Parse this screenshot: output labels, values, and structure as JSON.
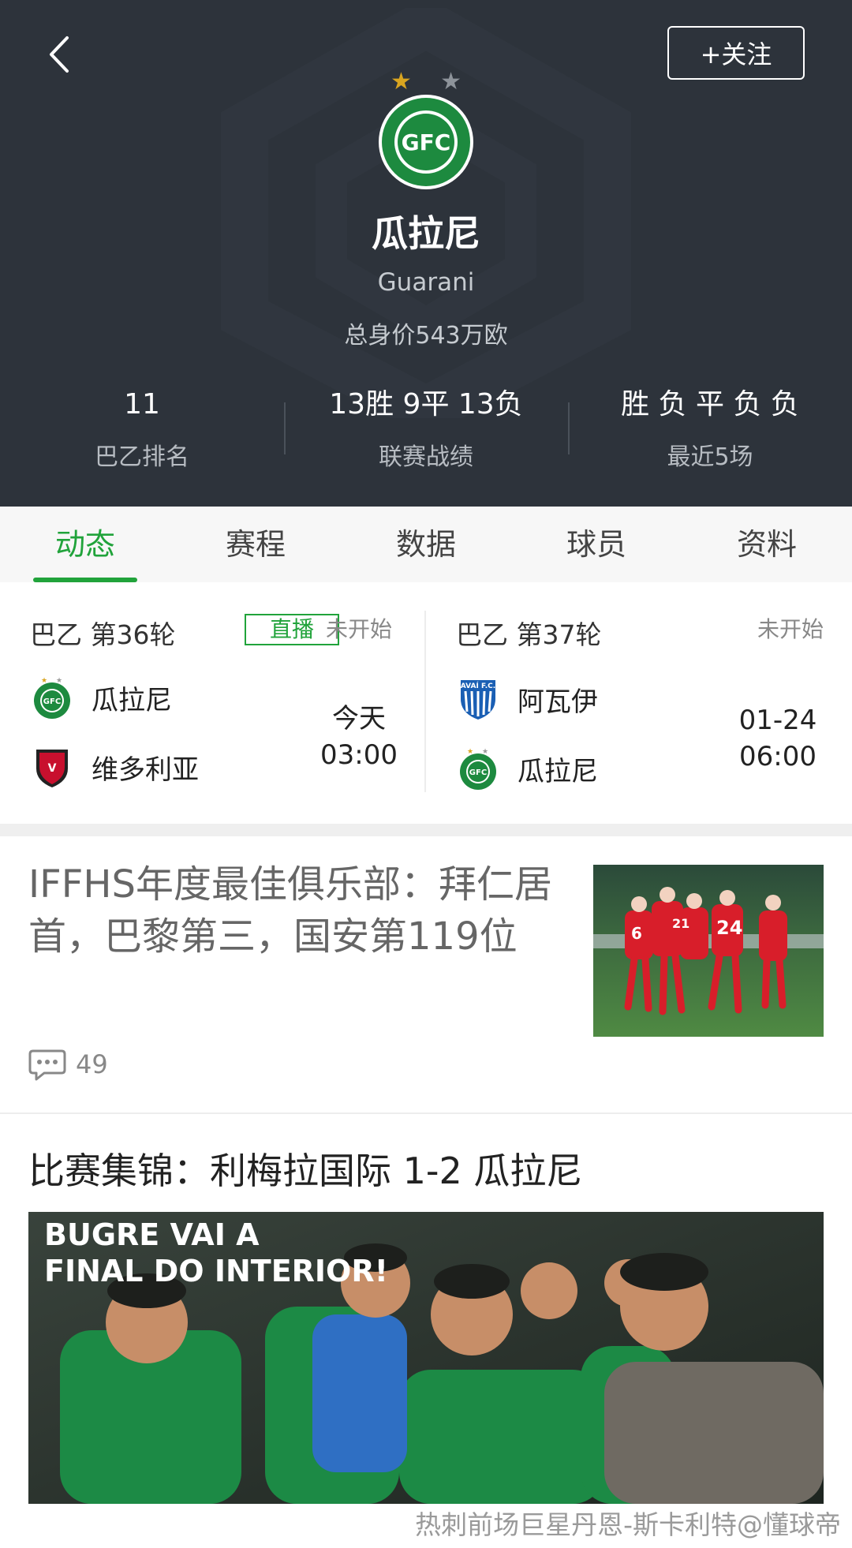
{
  "header": {
    "follow_label": "+关注",
    "team_name": "瓜拉尼",
    "team_name_en": "Guarani",
    "total_value": "总身价543万欧",
    "stats": [
      {
        "value": "11",
        "label": "巴乙排名"
      },
      {
        "value": "13胜 9平 13负",
        "label": "联赛战绩"
      },
      {
        "value": "胜 负 平 负 负",
        "label": "最近5场"
      }
    ],
    "colors": {
      "bg": "#2d333b",
      "star_gold": "#d9a520",
      "star_gray": "#8d939a"
    }
  },
  "tabs": [
    "动态",
    "赛程",
    "数据",
    "球员",
    "资料"
  ],
  "matches": [
    {
      "round": "巴乙 第36轮",
      "live": "直播",
      "status": "未开始",
      "home": "瓜拉尼",
      "away": "维多利亚",
      "date": "今天",
      "time": "03:00"
    },
    {
      "round": "巴乙 第37轮",
      "status": "未开始",
      "home": "阿瓦伊",
      "away": "瓜拉尼",
      "date": "01-24",
      "time": "06:00"
    }
  ],
  "articles": [
    {
      "title": "IFFHS年度最佳俱乐部：拜仁居首，巴黎第三，国安第119位",
      "comments": "49",
      "thumb_jersey_numbers": [
        "6",
        "21",
        "24"
      ]
    },
    {
      "title": "比赛集锦：利梅拉国际 1-2 瓜拉尼",
      "image_caption_lines": [
        "BUGRE VAI A",
        "FINAL DO INTERIOR!"
      ]
    }
  ],
  "watermark": "热刺前场巨星丹恩-斯卡利特@懂球帝",
  "accent_color": "#21a33b"
}
